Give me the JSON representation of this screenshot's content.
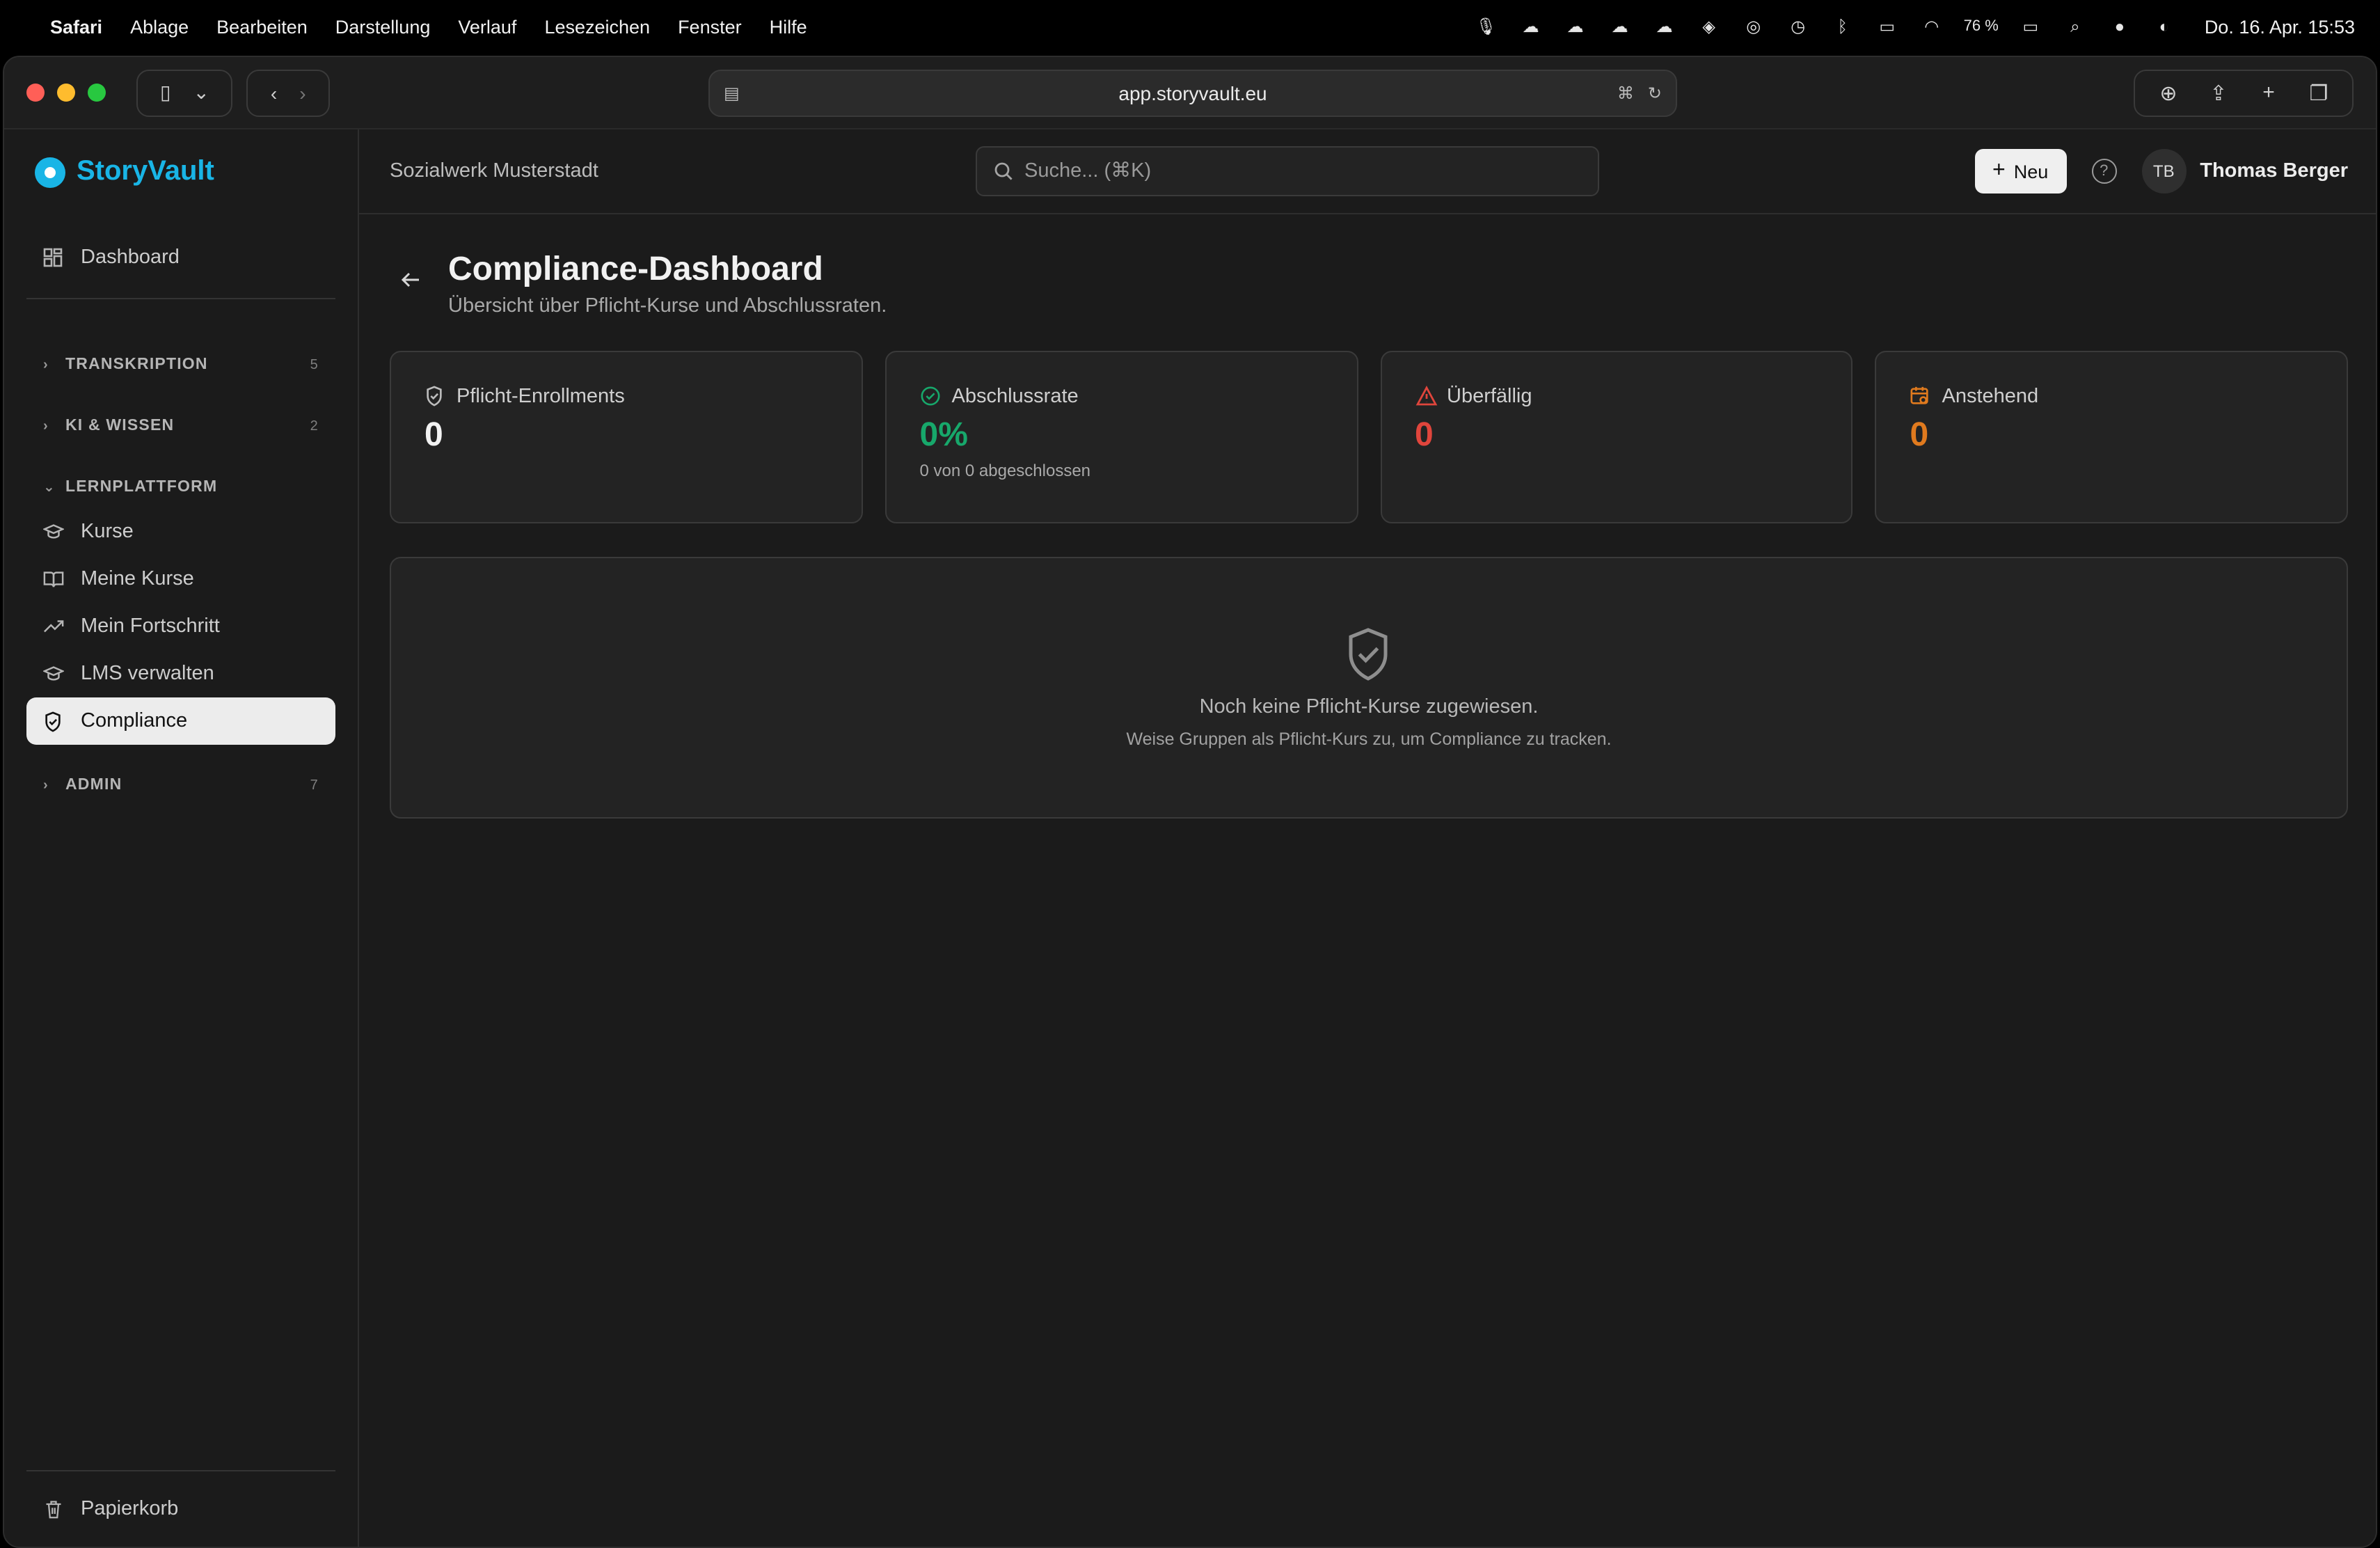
{
  "menubar": {
    "app": "Safari",
    "items": [
      "Ablage",
      "Bearbeiten",
      "Darstellung",
      "Verlauf",
      "Lesezeichen",
      "Fenster",
      "Hilfe"
    ],
    "battery": "76 %",
    "clock": "Do. 16. Apr.  15:53"
  },
  "browser": {
    "url": "app.storyvault.eu"
  },
  "sidebar": {
    "brand": "StoryVault",
    "dashboard": "Dashboard",
    "sections": [
      {
        "label": "TRANSKRIPTION",
        "count": "5"
      },
      {
        "label": "KI & WISSEN",
        "count": "2"
      },
      {
        "label": "LERNPLATTFORM",
        "count": ""
      },
      {
        "label": "ADMIN",
        "count": "7"
      }
    ],
    "lern_items": [
      "Kurse",
      "Meine Kurse",
      "Mein Fortschritt",
      "LMS verwalten",
      "Compliance"
    ],
    "trash": "Papierkorb"
  },
  "topbar": {
    "org": "Sozialwerk Musterstadt",
    "search_placeholder": "Suche... (⌘K)",
    "new_label": "Neu",
    "user_initials": "TB",
    "user_name": "Thomas Berger"
  },
  "page": {
    "title": "Compliance-Dashboard",
    "subtitle": "Übersicht über Pflicht-Kurse und Abschlussraten."
  },
  "stats": [
    {
      "label": "Pflicht-Enrollments",
      "value": "0",
      "note": ""
    },
    {
      "label": "Abschlussrate",
      "value": "0%",
      "note": "0 von 0 abgeschlossen"
    },
    {
      "label": "Überfällig",
      "value": "0",
      "note": ""
    },
    {
      "label": "Anstehend",
      "value": "0",
      "note": ""
    }
  ],
  "empty": {
    "title": "Noch keine Pflicht-Kurse zugewiesen.",
    "subtitle": "Weise Gruppen als Pflicht-Kurs zu, um Compliance zu tracken."
  },
  "colors": {
    "accent": "#19b5e6",
    "green": "#17a86b",
    "red": "#e0453c",
    "orange": "#e07a1e"
  }
}
